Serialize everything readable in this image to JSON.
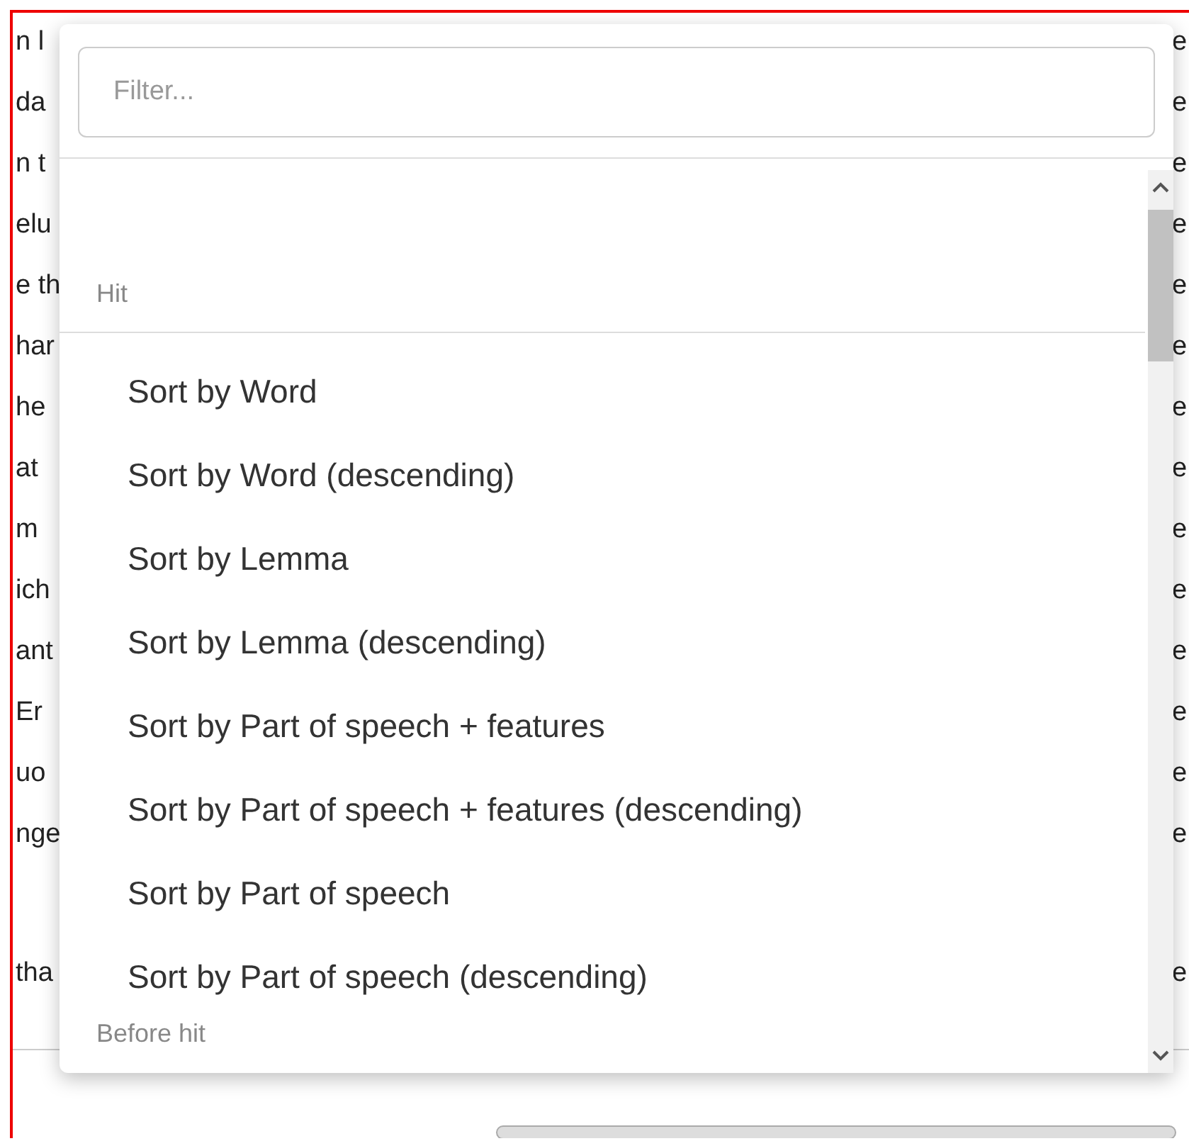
{
  "background_rows": [
    {
      "left": "n l",
      "right": "e"
    },
    {
      "left": "da",
      "right": "e"
    },
    {
      "left": "n t",
      "right": "e"
    },
    {
      "left": "elu",
      "right": "e"
    },
    {
      "left": "e th",
      "right": "e"
    },
    {
      "left": "har",
      "right": "e"
    },
    {
      "left": "he",
      "right": "e"
    },
    {
      "left": "at",
      "right": "e"
    },
    {
      "left": "m",
      "right": "e"
    },
    {
      "left": "ich",
      "right": "e"
    },
    {
      "left": "ant",
      "right": "e"
    },
    {
      "left": "Er",
      "right": "e"
    },
    {
      "left": "uo",
      "right": "e"
    },
    {
      "left": "nge",
      "right": "e"
    }
  ],
  "lower_rows": [
    {
      "left": "tha",
      "right": "e"
    }
  ],
  "dropdown": {
    "filter": {
      "placeholder": "Filter..."
    },
    "groups": [
      {
        "header": "Hit",
        "items": [
          "Sort by Word",
          "Sort by Word (descending)",
          "Sort by Lemma",
          "Sort by Lemma (descending)",
          "Sort by Part of speech + features",
          "Sort by Part of speech + features (descending)",
          "Sort by Part of speech",
          "Sort by Part of speech (descending)"
        ]
      },
      {
        "header": "Before hit"
      }
    ]
  }
}
